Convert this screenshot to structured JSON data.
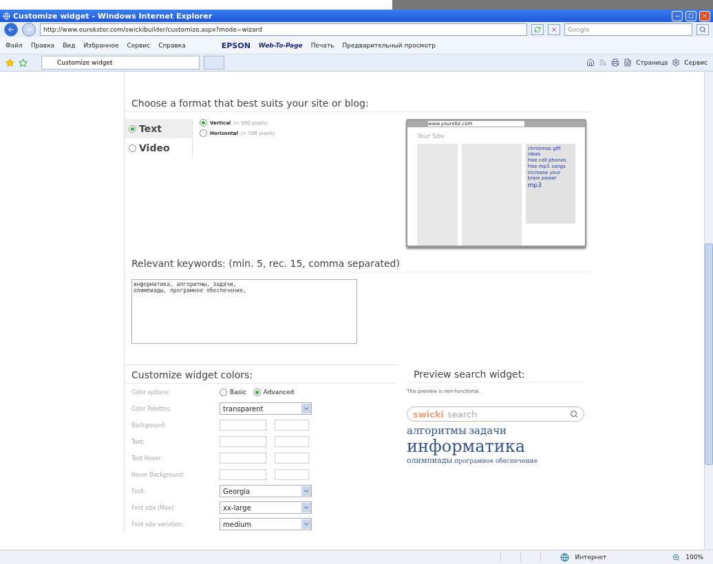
{
  "window": {
    "title": "Customize widget - Windows Internet Explorer"
  },
  "address_bar": {
    "url": "http://www.eurekster.com/swickibuilder/customize.aspx?mode=wizard",
    "search_placeholder": "Google"
  },
  "menu": [
    "Файл",
    "Правка",
    "Вид",
    "Избранное",
    "Сервис",
    "Справка"
  ],
  "epson_toolbar": {
    "brand": "EPSON",
    "web_to_page": "Web-To-Page",
    "print": "Печать",
    "preview": "Предварительный просмотр"
  },
  "tabs": [
    {
      "label": "Customize widget",
      "selected": true
    }
  ],
  "command_bar": {
    "page": "Страница",
    "tools": "Сервис"
  },
  "format_section": {
    "heading": "Choose a format that best suits your site or blog:",
    "formats": [
      {
        "label": "Text",
        "selected": true
      },
      {
        "label": "Video",
        "selected": false
      }
    ],
    "orientations": [
      {
        "label": "Vertical",
        "hint": "(< 500 pixels)",
        "selected": true
      },
      {
        "label": "Horizontal",
        "hint": "(> 500 pixels)",
        "selected": false
      }
    ],
    "mockup": {
      "url": "www.yoursite.com",
      "site_title": "Your Site",
      "tags": [
        "christmas gift ideas",
        "free cell phones",
        "free mp3",
        "songs",
        "increase your brain power",
        "mp3"
      ]
    }
  },
  "keywords_section": {
    "heading": "Relevant keywords: (min. 5, rec. 15, comma separated)",
    "value": "информатика, алгоритмы, задачи,\nолимпиады, програмное обеспечение,"
  },
  "colors_section": {
    "heading": "Customize widget colors:",
    "rows": [
      {
        "kind": "radio",
        "label": "Color options:",
        "options": [
          {
            "label": "Basic",
            "selected": false
          },
          {
            "label": "Advanced",
            "selected": true
          }
        ]
      },
      {
        "kind": "select",
        "label": "Color Palettes:",
        "value": "transparent"
      },
      {
        "kind": "pair",
        "label": "Background:"
      },
      {
        "kind": "pair",
        "label": "Text:"
      },
      {
        "kind": "pair",
        "label": "Text Hover:"
      },
      {
        "kind": "pair",
        "label": "Hover Background:"
      },
      {
        "kind": "select",
        "label": "Font:",
        "value": "Georgia"
      },
      {
        "kind": "select",
        "label": "Font size (Max):",
        "value": "xx-large"
      },
      {
        "kind": "select",
        "label": "Font size variation:",
        "value": "medium"
      }
    ]
  },
  "preview_section": {
    "heading": "Preview search widget:",
    "note": "This preview is non-functional.",
    "logo": "swicki",
    "placeholder": "search",
    "tags": [
      {
        "text": "алгоритмы",
        "kind": "medium"
      },
      {
        "text": "задачи",
        "kind": "medium"
      },
      {
        "text": "информатика",
        "kind": "large"
      },
      {
        "text": "олимпиады",
        "kind": "small"
      },
      {
        "text": "програмное обеспечение",
        "kind": "tiny"
      }
    ]
  },
  "status_bar": {
    "zone": "Интернет",
    "zoom": "100%"
  }
}
